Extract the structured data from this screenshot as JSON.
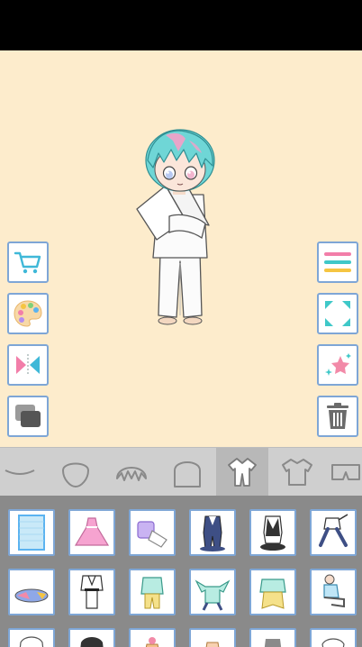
{
  "status_bar": {},
  "toolbar": {
    "left": [
      {
        "name": "shop-button",
        "icon": "shopping-cart-icon"
      },
      {
        "name": "palette-button",
        "icon": "color-palette-icon"
      },
      {
        "name": "flip-button",
        "icon": "mirror-flip-icon"
      },
      {
        "name": "layer-button",
        "icon": "layer-stack-icon"
      }
    ],
    "right": [
      {
        "name": "menu-button",
        "icon": "menu-lines-icon"
      },
      {
        "name": "fullscreen-button",
        "icon": "expand-corners-icon"
      },
      {
        "name": "effects-button",
        "icon": "sparkle-star-icon"
      },
      {
        "name": "trash-button",
        "icon": "trash-can-icon"
      }
    ]
  },
  "categories": [
    {
      "name": "mouth",
      "icon": "mouth-icon"
    },
    {
      "name": "face",
      "icon": "face-outline-icon"
    },
    {
      "name": "front-hair",
      "icon": "bangs-icon"
    },
    {
      "name": "back-hair",
      "icon": "back-hair-icon"
    },
    {
      "name": "set-outfit",
      "icon": "jumpsuit-icon",
      "active": true
    },
    {
      "name": "top",
      "icon": "tshirt-icon"
    },
    {
      "name": "bottom",
      "icon": "shorts-icon"
    }
  ],
  "items": [
    {
      "name": "blank-blue-item",
      "icon": "blue-panel-icon"
    },
    {
      "name": "pink-dress-item",
      "icon": "pink-dress-icon"
    },
    {
      "name": "purple-pajama-item",
      "icon": "purple-pajama-icon"
    },
    {
      "name": "navy-suit-item",
      "icon": "navy-suit-icon"
    },
    {
      "name": "black-vest-item",
      "icon": "black-vest-icon"
    },
    {
      "name": "sporty-pose-item",
      "icon": "running-outfit-icon"
    },
    {
      "name": "lying-outfit-item",
      "icon": "lying-outfit-icon"
    },
    {
      "name": "karate-gi-item",
      "icon": "karate-gi-icon"
    },
    {
      "name": "mint-pajama-item",
      "icon": "mint-pajama-icon"
    },
    {
      "name": "mint-jump-item",
      "icon": "mint-jump-icon"
    },
    {
      "name": "mint-dance-item",
      "icon": "mint-dance-icon"
    },
    {
      "name": "sitting-outfit-item",
      "icon": "sitting-outfit-icon"
    }
  ],
  "colors": {
    "stage": "#fdeccc",
    "accent_border": "#7ea6d6",
    "category_bar": "#cfcfcf",
    "items_panel": "#8a8a8a",
    "hair": "#6fd6d6",
    "hair_highlight": "#f4a0c8"
  }
}
